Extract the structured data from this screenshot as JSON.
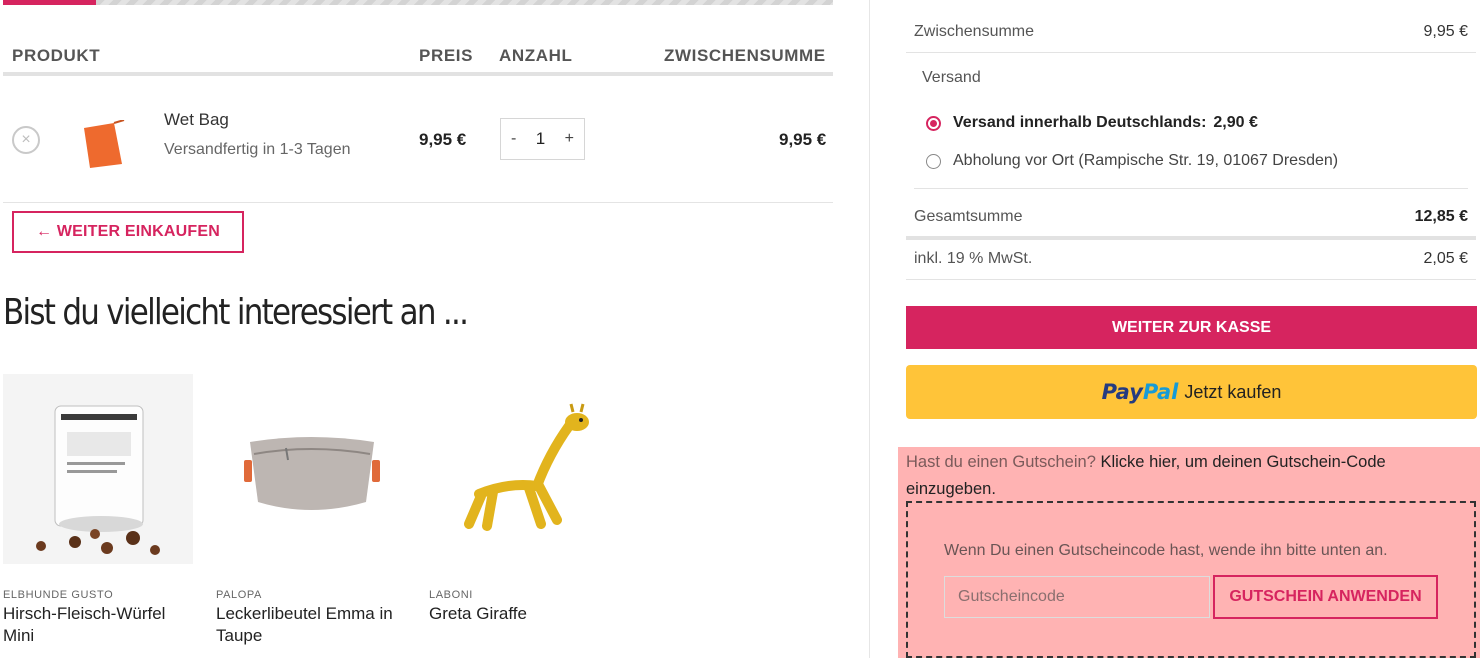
{
  "cart": {
    "headers": {
      "product": "PRODUKT",
      "price": "PREIS",
      "qty": "ANZAHL",
      "subtotal": "ZWISCHENSUMME"
    },
    "item": {
      "remove_label": "×",
      "name": "Wet Bag",
      "shipping": "Versandfertig in 1-3 Tagen",
      "price": "9,95 €",
      "qty_minus": "-",
      "qty": "1",
      "qty_plus": "+",
      "subtotal": "9,95 €"
    },
    "continue_label": "← WEITER EINKAUFEN"
  },
  "upsell": {
    "title": "Bist du vielleicht interessiert an ...",
    "products": [
      {
        "brand": "ELBHUNDE GUSTO",
        "title": "Hirsch-Fleisch-Würfel Mini"
      },
      {
        "brand": "PALOPA",
        "title": "Leckerlibeutel Emma in Taupe"
      },
      {
        "brand": "LABONI",
        "title": "Greta Giraffe"
      }
    ]
  },
  "totals": {
    "subtotal_label": "Zwischensumme",
    "subtotal_value": "9,95 €",
    "shipping_label": "Versand",
    "shipping_options": [
      {
        "label": "Versand innerhalb Deutschlands:",
        "price": "2,90 €",
        "selected": true
      },
      {
        "label": "Abholung vor Ort (Rampische Str. 19, 01067 Dresden)",
        "price": "",
        "selected": false
      }
    ],
    "total_label": "Gesamtsumme",
    "total_value": "12,85 €",
    "tax_label": "inkl. 19 % MwSt.",
    "tax_value": "2,05 €",
    "checkout_label": "WEITER ZUR KASSE",
    "paypal": {
      "logo_1": "Pay",
      "logo_2": "Pal",
      "text": "Jetzt kaufen"
    }
  },
  "coupon": {
    "question": "Hast du einen Gutschein?",
    "link": "Klicke hier, um deinen Gutschein-Code einzugeben.",
    "hint": "Wenn Du einen Gutscheincode hast, wende ihn bitte unten an.",
    "placeholder": "Gutscheincode",
    "apply_label": "GUTSCHEIN ANWENDEN"
  },
  "colors": {
    "accent": "#d6245f",
    "paypal": "#ffc439",
    "coupon_bg": "#ffb3b3"
  }
}
